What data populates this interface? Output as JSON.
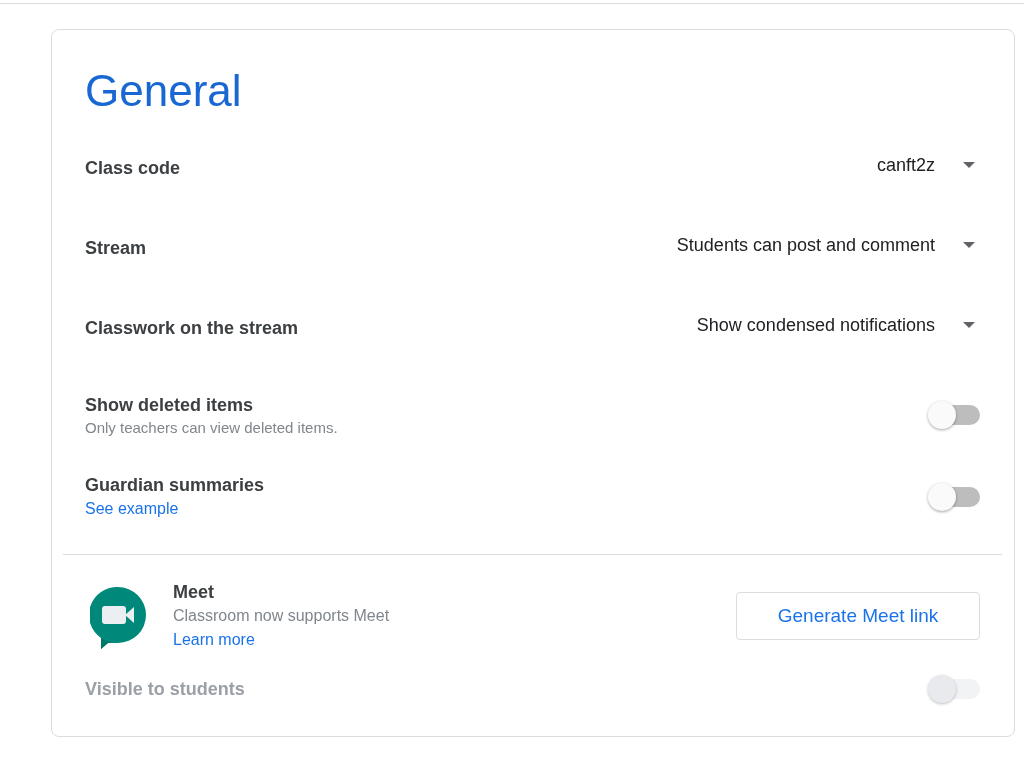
{
  "title": "General",
  "settings": [
    {
      "kind": "dropdown",
      "label": "Class code",
      "value": "canft2z"
    },
    {
      "kind": "dropdown",
      "label": "Stream",
      "value": "Students can post and comment"
    },
    {
      "kind": "dropdown",
      "label": "Classwork on the stream",
      "value": "Show condensed notifications"
    },
    {
      "kind": "toggle",
      "label": "Show deleted items",
      "description": "Only teachers can view deleted items.",
      "on": false
    },
    {
      "kind": "toggle",
      "label": "Guardian summaries",
      "link": "See example",
      "on": false
    }
  ],
  "meet": {
    "title": "Meet",
    "description": "Classroom now supports Meet",
    "link": "Learn more",
    "button": "Generate Meet link",
    "visibility": {
      "label": "Visible to students",
      "on": false,
      "disabled": true
    }
  }
}
